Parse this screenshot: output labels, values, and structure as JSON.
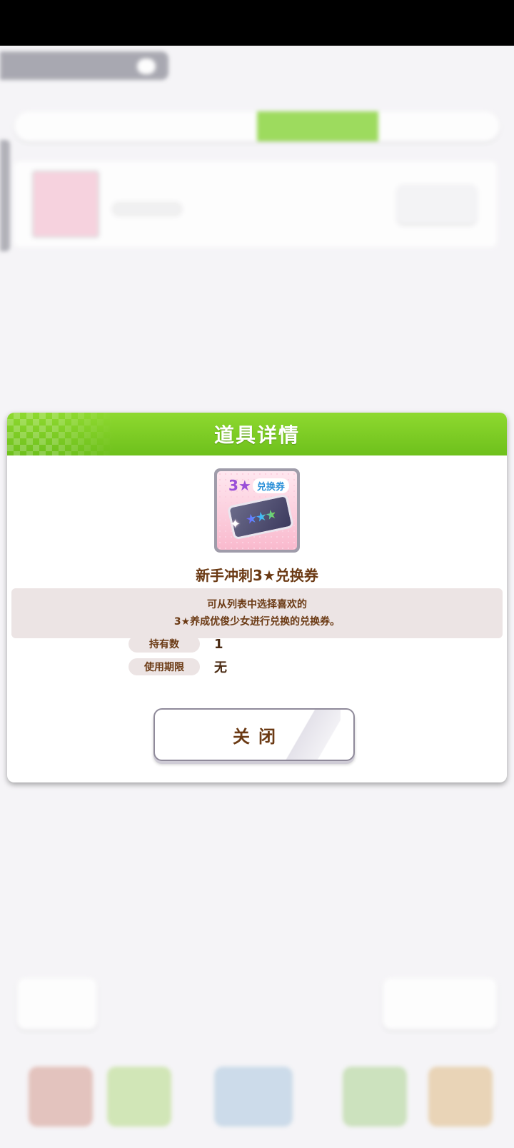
{
  "dialog": {
    "title": "道具详情",
    "item_name": "新手冲刺3★兑换券",
    "icon": "three-star-exchange-ticket-icon",
    "icon_badge_number": "3★",
    "icon_badge_text": "兑换券",
    "icon_stars": "★★★",
    "description_lines": [
      "可从列表中选择喜欢的",
      "3★养成优俊少女进行兑换的兑换券。"
    ],
    "owned_label": "持有数",
    "owned_value": "1",
    "expiry_label": "使用期限",
    "expiry_value": "无",
    "close_label": "关闭"
  },
  "colors": {
    "header_green": "#7fd12a",
    "brown_text": "#6b3a14",
    "label_bg": "#ece4e4"
  }
}
